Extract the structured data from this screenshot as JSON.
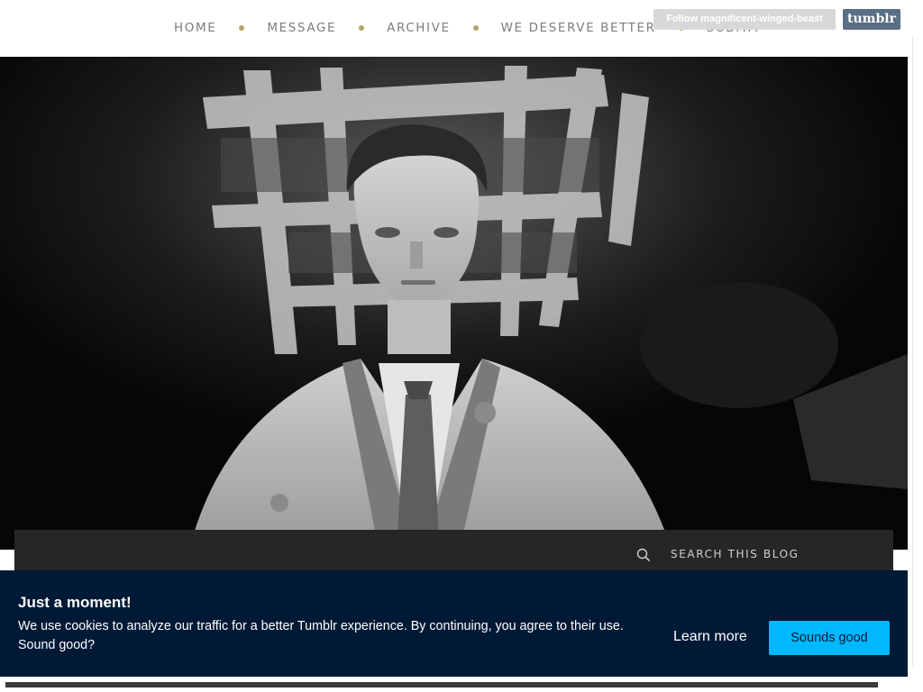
{
  "nav": {
    "items": [
      {
        "label": "HOME"
      },
      {
        "label": "MESSAGE"
      },
      {
        "label": "ARCHIVE"
      },
      {
        "label": "WE DESERVE BETTER"
      },
      {
        "label": "SUBMIT"
      }
    ],
    "dot_color": "#b3a46a"
  },
  "tumblr_controls": {
    "follow_label": "Follow magnificent-winged-beast",
    "logo_label": "tumblr",
    "logo_color": "#5a6e85"
  },
  "header_image": {
    "icon": "header-photo"
  },
  "search": {
    "label": "SEARCH THIS BLOG",
    "icon": "search-icon"
  },
  "cookie_banner": {
    "title": "Just a moment!",
    "text": "We use cookies to analyze our traffic for a better Tumblr experience. By continuing, you agree to their use. Sound good?",
    "learn_more_label": "Learn more",
    "accept_label": "Sounds good",
    "background_color": "#001935",
    "accept_color": "#00b8ff"
  }
}
